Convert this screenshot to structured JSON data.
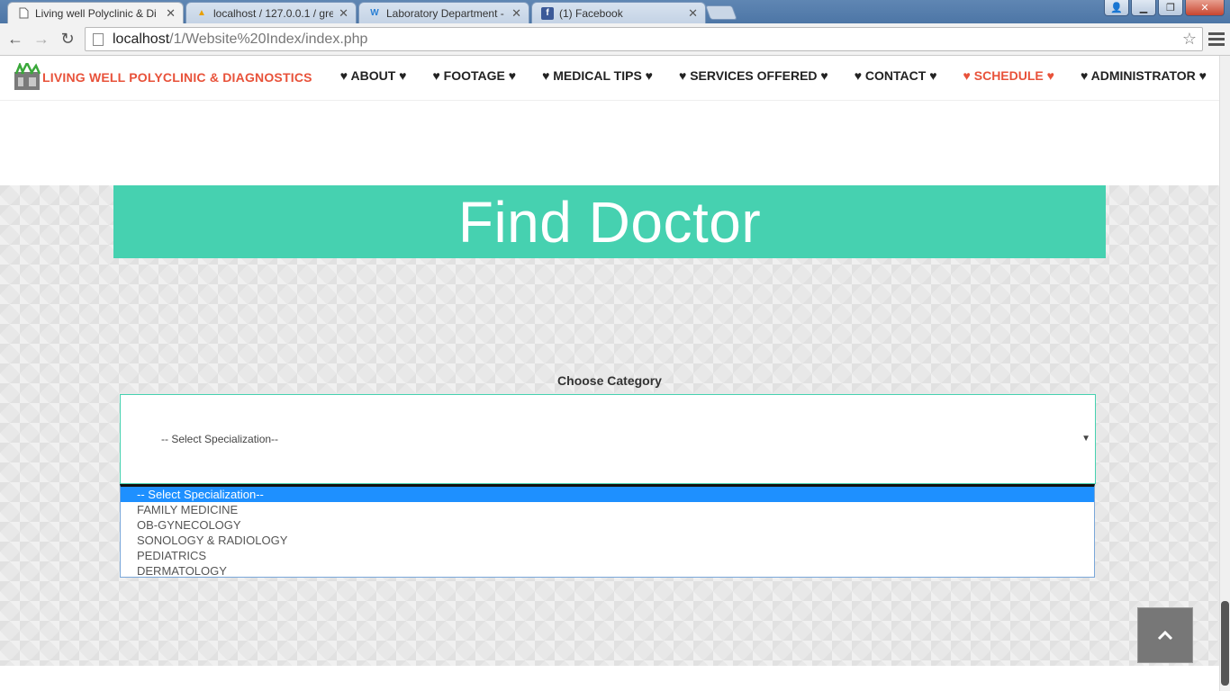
{
  "browser": {
    "tabs": [
      {
        "title": "Living well Polyclinic & Di",
        "icon": "page-icon",
        "active": true
      },
      {
        "title": "localhost / 127.0.0.1 / gre",
        "icon": "pma-icon",
        "active": false
      },
      {
        "title": "Laboratory Department -",
        "icon": "w-icon",
        "active": false
      },
      {
        "title": "(1) Facebook",
        "icon": "facebook-icon",
        "active": false
      }
    ],
    "url_host": "localhost",
    "url_path": "/1/Website%20Index/index.php"
  },
  "site": {
    "brand": "LIVING WELL POLYCLINIC & DIAGNOSTICS",
    "brand_color": "#e8523a",
    "menu": [
      {
        "label": "♥ ABOUT ♥"
      },
      {
        "label": "♥ FOOTAGE ♥"
      },
      {
        "label": "♥ MEDICAL TIPS ♥"
      },
      {
        "label": "♥ SERVICES OFFERED ♥"
      },
      {
        "label": "♥ CONTACT ♥"
      },
      {
        "label": "♥ SCHEDULE ♥",
        "active": true
      },
      {
        "label": "♥ ADMINISTRATOR ♥"
      }
    ]
  },
  "main": {
    "hero_title": "Find Doctor",
    "hero_color": "#46d1b0",
    "category_label": "Choose Category",
    "select_value": "-- Select Specialization--",
    "options": [
      "-- Select Specialization--",
      "FAMILY MEDICINE",
      "OB-GYNECOLOGY",
      "SONOLOGY & RADIOLOGY",
      "PEDIATRICS",
      "DERMATOLOGY"
    ],
    "highlighted_option": 0
  }
}
